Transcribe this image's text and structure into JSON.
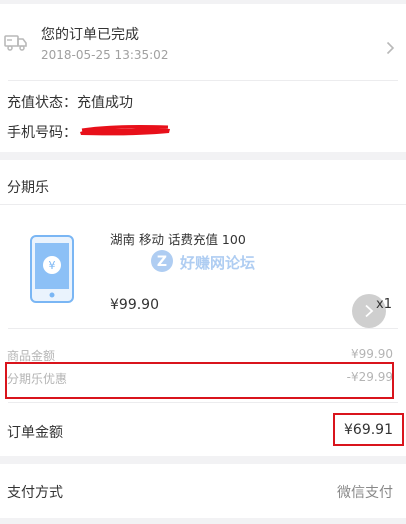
{
  "order_status": {
    "title": "您的订单已完成",
    "timestamp": "2018-05-25 13:35:02"
  },
  "recharge_info": {
    "status_label": "充值状态：",
    "status_value": "充值成功",
    "phone_label": "手机号码："
  },
  "store": {
    "name": "分期乐"
  },
  "product": {
    "name": "湖南 移动 话费充值 100",
    "price": "¥99.90",
    "quantity": "x1"
  },
  "watermark": {
    "text": "好赚网论坛"
  },
  "summary": {
    "goods_amount_label": "商品金额",
    "goods_amount_value": "¥99.90",
    "discount_label": "分期乐优惠",
    "discount_value": "-¥29.99",
    "order_total_label": "订单金额",
    "order_total_value": "¥69.91"
  },
  "payment": {
    "label": "支付方式",
    "value": "微信支付"
  },
  "colors": {
    "highlight_box": "#d9141c",
    "redaction": "#e8101a",
    "phone_icon": "#7ab6f4"
  }
}
